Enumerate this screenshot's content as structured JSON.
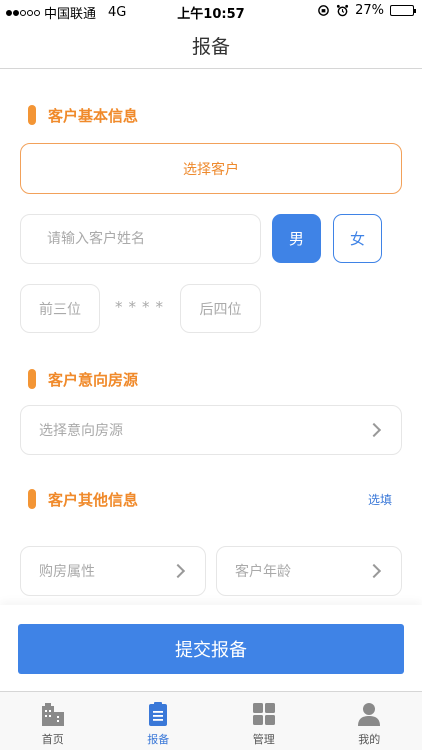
{
  "status_bar": {
    "carrier": "中国联通",
    "network": "4G",
    "time": "上午10:57",
    "battery": "27%",
    "battery_level": 0.27
  },
  "nav": {
    "title": "报备"
  },
  "sections": {
    "basic": {
      "title": "客户基本信息"
    },
    "property": {
      "title": "客户意向房源"
    },
    "other": {
      "title": "客户其他信息",
      "optional_label": "选填"
    }
  },
  "basic": {
    "select_customer": "选择客户",
    "name_placeholder": "请输入客户姓名",
    "gender_male": "男",
    "gender_female": "女",
    "phone_prefix_placeholder": "前三位",
    "phone_mask": "****",
    "phone_suffix_placeholder": "后四位"
  },
  "property": {
    "placeholder": "选择意向房源"
  },
  "other": {
    "purchase_attr": "购房属性",
    "customer_age": "客户年龄"
  },
  "submit_label": "提交报备",
  "tabs": [
    {
      "label": "首页",
      "icon": "building-icon"
    },
    {
      "label": "报备",
      "icon": "clipboard-icon"
    },
    {
      "label": "管理",
      "icon": "grid-icon"
    },
    {
      "label": "我的",
      "icon": "person-icon"
    }
  ],
  "colors": {
    "accent_orange": "#f39535",
    "primary_blue": "#3f83e6"
  }
}
